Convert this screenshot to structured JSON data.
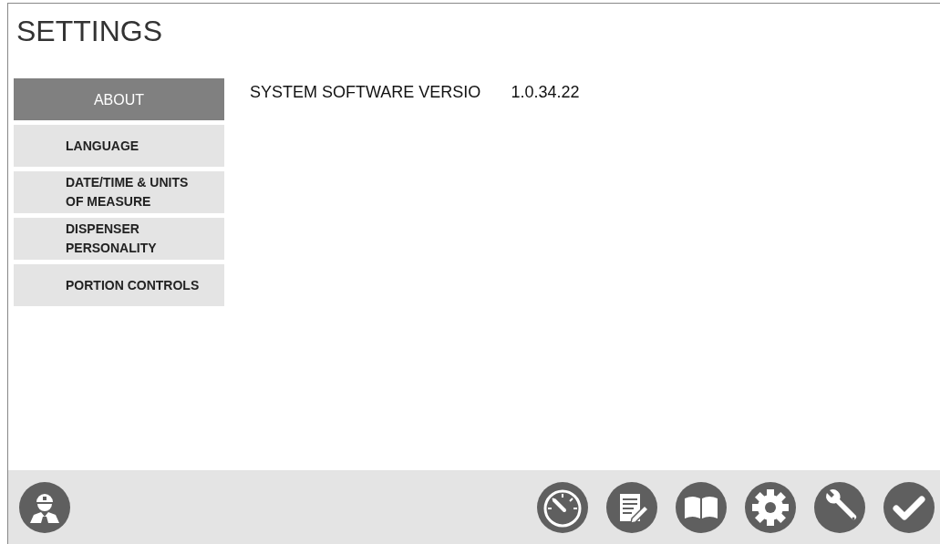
{
  "title": "SETTINGS",
  "sidebar": {
    "items": [
      {
        "label": "ABOUT",
        "selected": true
      },
      {
        "label": "LANGUAGE",
        "selected": false
      },
      {
        "label": "DATE/TIME & UNITS OF MEASURE",
        "selected": false
      },
      {
        "label": "DISPENSER PERSONALITY",
        "selected": false
      },
      {
        "label": "PORTION CONTROLS",
        "selected": false
      }
    ]
  },
  "details": [
    {
      "label": "SYSTEM SOFTWARE VERSIO",
      "value": "1.0.34.22"
    }
  ],
  "footer": {
    "left": [
      {
        "kind": "user"
      }
    ],
    "right": [
      {
        "kind": "gauge"
      },
      {
        "kind": "notes"
      },
      {
        "kind": "book"
      },
      {
        "kind": "settings"
      },
      {
        "kind": "wrench"
      },
      {
        "kind": "check"
      }
    ]
  }
}
